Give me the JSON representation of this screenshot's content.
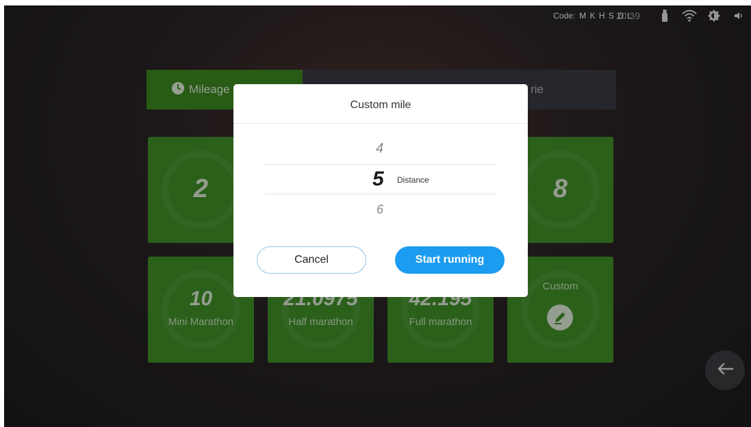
{
  "status_bar": {
    "code_label": "Code:",
    "code_value": "M K H S D L",
    "clock": "20:39",
    "icons": [
      "usb-icon",
      "wifi-icon",
      "brightness-icon",
      "volume-icon"
    ]
  },
  "tabs": [
    {
      "label": "Mileage",
      "icon": "clock-icon",
      "selected": true
    },
    {
      "label": "rie",
      "selected": false
    }
  ],
  "tiles": [
    {
      "value": "2",
      "caption": ""
    },
    {
      "value": "8",
      "caption": ""
    },
    {
      "value": "10",
      "caption": "Mini Marathon"
    },
    {
      "value": "21.0975",
      "caption": "Half marathon"
    },
    {
      "value": "42.195",
      "caption": "Full marathon"
    },
    {
      "value": "",
      "caption": "Custom",
      "icon": "edit-icon"
    }
  ],
  "modal": {
    "title": "Custom mile",
    "picker": {
      "prev": "4",
      "selected": "5",
      "next": "6",
      "unit_label": "Distance"
    },
    "cancel_label": "Cancel",
    "start_label": "Start running"
  },
  "colors": {
    "tile_green": "#42942a",
    "tab_green": "#3e8c22",
    "accent_blue": "#1c9cf0",
    "cancel_border": "#8cc6e8"
  },
  "back_button_icon": "arrow-left-icon"
}
